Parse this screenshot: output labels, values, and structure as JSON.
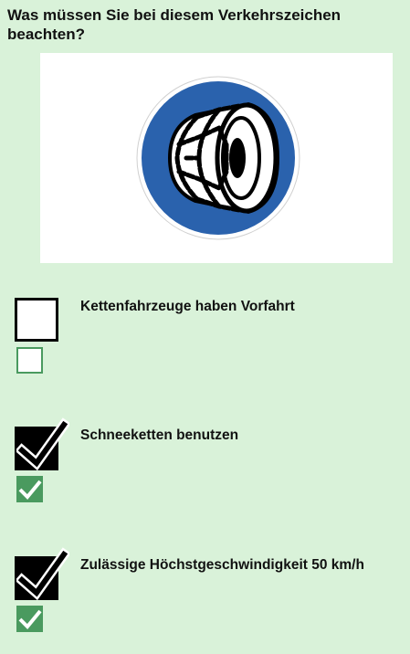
{
  "question": "Was müssen Sie bei diesem Verkehrszeichen beachten?",
  "sign": {
    "icon": "snow-chains-sign-icon",
    "circle_color": "#2a62ad"
  },
  "answers": [
    {
      "label": "Kettenfahrzeuge haben Vorfahrt",
      "selected": false,
      "correct": false
    },
    {
      "label": "Schneeketten benutzen",
      "selected": true,
      "correct": true
    },
    {
      "label": "Zulässige Höchstgeschwindigkeit 50 km/h",
      "selected": true,
      "correct": true
    }
  ],
  "colors": {
    "background": "#d9f2d9",
    "correct_green": "#4a9a5f"
  }
}
